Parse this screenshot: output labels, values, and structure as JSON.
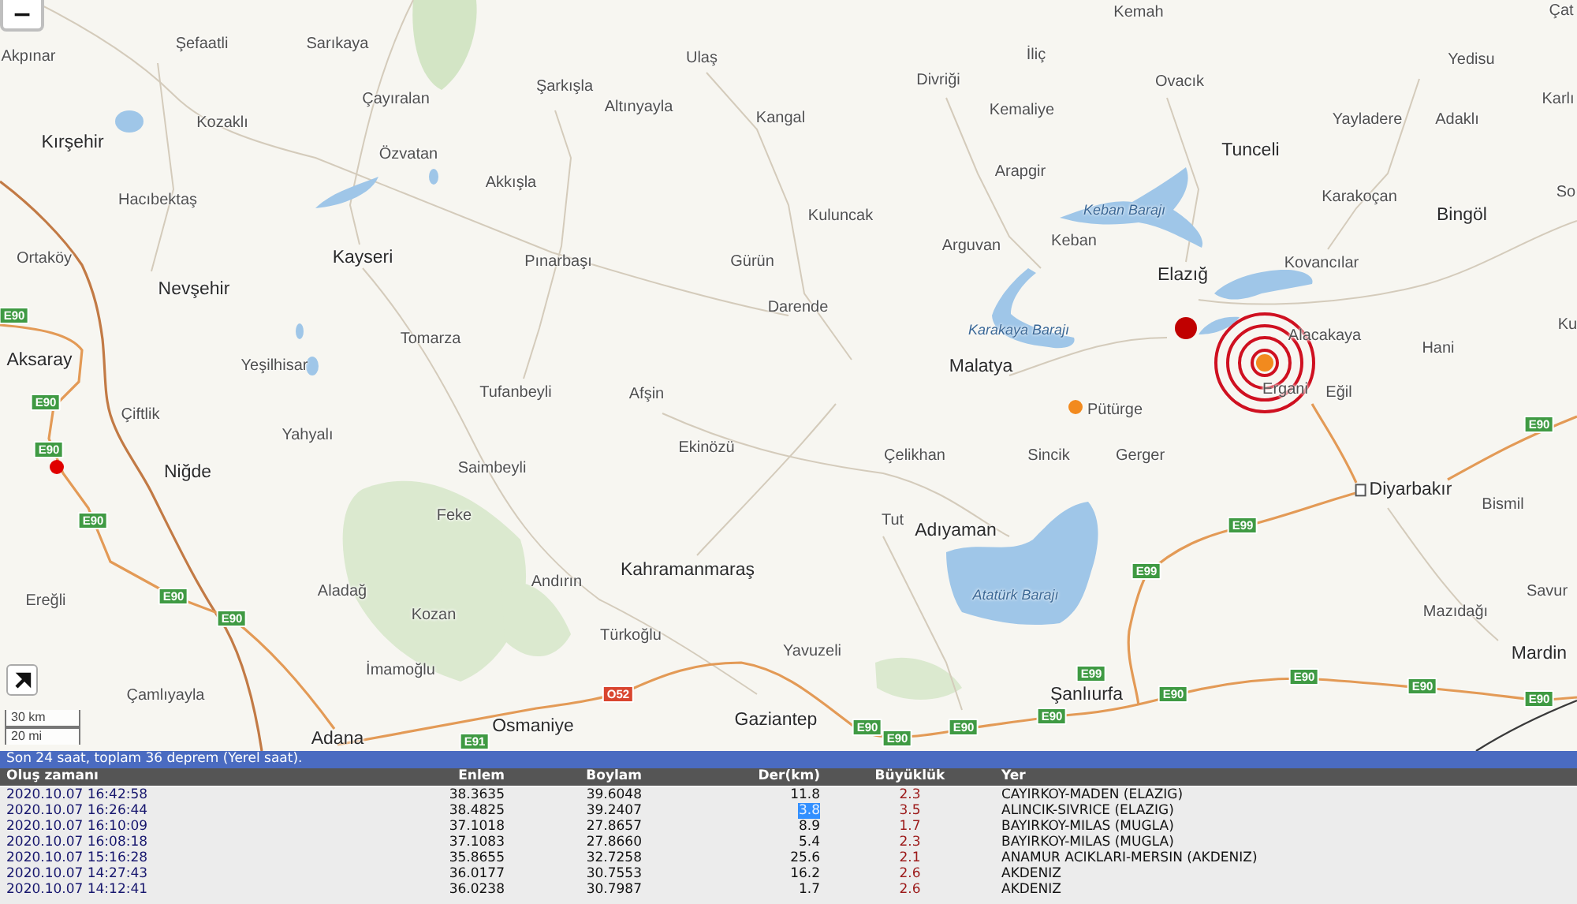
{
  "map": {
    "zoom_out": "−",
    "scale": [
      "30 km",
      "20 mi"
    ],
    "places": [
      {
        "name": "Kemah",
        "kind": "town"
      },
      {
        "name": "Çat",
        "kind": "town"
      },
      {
        "name": "Şefaatli",
        "kind": "town"
      },
      {
        "name": "Sarıkaya",
        "kind": "town"
      },
      {
        "name": "Akpınar",
        "kind": "town"
      },
      {
        "name": "Ulaş",
        "kind": "town"
      },
      {
        "name": "İliç",
        "kind": "town"
      },
      {
        "name": "Yedisu",
        "kind": "town"
      },
      {
        "name": "Şarkışla",
        "kind": "town"
      },
      {
        "name": "Divriği",
        "kind": "town"
      },
      {
        "name": "Ovacık",
        "kind": "town"
      },
      {
        "name": "Çayıralan",
        "kind": "town"
      },
      {
        "name": "Karlı",
        "kind": "town"
      },
      {
        "name": "Kozaklı",
        "kind": "town"
      },
      {
        "name": "Altınyayla",
        "kind": "town"
      },
      {
        "name": "Kangal",
        "kind": "town"
      },
      {
        "name": "Kemaliye",
        "kind": "town"
      },
      {
        "name": "Yayladere",
        "kind": "town"
      },
      {
        "name": "Adaklı",
        "kind": "town"
      },
      {
        "name": "Kırşehir",
        "kind": "city"
      },
      {
        "name": "Özvatan",
        "kind": "town"
      },
      {
        "name": "Tunceli",
        "kind": "city"
      },
      {
        "name": "Arapgir",
        "kind": "town"
      },
      {
        "name": "Hacıbektaş",
        "kind": "town"
      },
      {
        "name": "Akkışla",
        "kind": "town"
      },
      {
        "name": "Karakoçan",
        "kind": "town"
      },
      {
        "name": "So",
        "kind": "town"
      },
      {
        "name": "Kuluncak",
        "kind": "town"
      },
      {
        "name": "Bingöl",
        "kind": "city"
      },
      {
        "name": "Ortaköy",
        "kind": "town"
      },
      {
        "name": "Kayseri",
        "kind": "city"
      },
      {
        "name": "Pınarbaşı",
        "kind": "town"
      },
      {
        "name": "Gürün",
        "kind": "town"
      },
      {
        "name": "Arguvan",
        "kind": "town"
      },
      {
        "name": "Keban",
        "kind": "town"
      },
      {
        "name": "Kovancılar",
        "kind": "town"
      },
      {
        "name": "Elazığ",
        "kind": "city"
      },
      {
        "name": "Nevşehir",
        "kind": "city"
      },
      {
        "name": "Darende",
        "kind": "town"
      },
      {
        "name": "Tomarza",
        "kind": "town"
      },
      {
        "name": "Alacakaya",
        "kind": "town"
      },
      {
        "name": "Hani",
        "kind": "town"
      },
      {
        "name": "Ku",
        "kind": "town"
      },
      {
        "name": "Aksaray",
        "kind": "city"
      },
      {
        "name": "Yeşilhisar",
        "kind": "town"
      },
      {
        "name": "Malatya",
        "kind": "city"
      },
      {
        "name": "Tufanbeyli",
        "kind": "town"
      },
      {
        "name": "Afşin",
        "kind": "town"
      },
      {
        "name": "Ergani",
        "kind": "town"
      },
      {
        "name": "Eğil",
        "kind": "town"
      },
      {
        "name": "Çiftlik",
        "kind": "town"
      },
      {
        "name": "Pütürge",
        "kind": "town"
      },
      {
        "name": "Yahyalı",
        "kind": "town"
      },
      {
        "name": "Ekinözü",
        "kind": "town"
      },
      {
        "name": "Çelikhan",
        "kind": "town"
      },
      {
        "name": "Sincik",
        "kind": "town"
      },
      {
        "name": "Gerger",
        "kind": "town"
      },
      {
        "name": "Niğde",
        "kind": "city"
      },
      {
        "name": "Saimbeyli",
        "kind": "town"
      },
      {
        "name": "Diyarbakır",
        "kind": "capital"
      },
      {
        "name": "Bismil",
        "kind": "town"
      },
      {
        "name": "Feke",
        "kind": "town"
      },
      {
        "name": "Tut",
        "kind": "town"
      },
      {
        "name": "Adıyaman",
        "kind": "city"
      },
      {
        "name": "Andırın",
        "kind": "town"
      },
      {
        "name": "Kahramanmaraş",
        "kind": "city"
      },
      {
        "name": "Ereğli",
        "kind": "town"
      },
      {
        "name": "Aladağ",
        "kind": "town"
      },
      {
        "name": "Kozan",
        "kind": "town"
      },
      {
        "name": "Mazıdağı",
        "kind": "town"
      },
      {
        "name": "Savur",
        "kind": "town"
      },
      {
        "name": "Türkoğlu",
        "kind": "town"
      },
      {
        "name": "Yavuzeli",
        "kind": "town"
      },
      {
        "name": "Mardin",
        "kind": "city"
      },
      {
        "name": "İmamoğlu",
        "kind": "town"
      },
      {
        "name": "Çamlıyayla",
        "kind": "town"
      },
      {
        "name": "Şanlıurfa",
        "kind": "city"
      },
      {
        "name": "Adana",
        "kind": "city"
      },
      {
        "name": "Osmaniye",
        "kind": "city"
      },
      {
        "name": "Gaziantep",
        "kind": "city"
      }
    ],
    "water_labels": [
      "Keban Barajı",
      "Karakaya Barajı",
      "Atatürk Barajı"
    ],
    "road_shields": [
      {
        "label": "E90",
        "color": "#3f9a43"
      },
      {
        "label": "E90",
        "color": "#3f9a43"
      },
      {
        "label": "E90",
        "color": "#3f9a43"
      },
      {
        "label": "E90",
        "color": "#3f9a43"
      },
      {
        "label": "E90",
        "color": "#3f9a43"
      },
      {
        "label": "E99",
        "color": "#3f9a43"
      },
      {
        "label": "E99",
        "color": "#3f9a43"
      },
      {
        "label": "E90",
        "color": "#3f9a43"
      },
      {
        "label": "E90",
        "color": "#3f9a43"
      },
      {
        "label": "O52",
        "color": "#d9452f"
      },
      {
        "label": "E99",
        "color": "#3f9a43"
      },
      {
        "label": "E90",
        "color": "#3f9a43"
      },
      {
        "label": "E90",
        "color": "#3f9a43"
      },
      {
        "label": "E90",
        "color": "#3f9a43"
      },
      {
        "label": "E90",
        "color": "#3f9a43"
      },
      {
        "label": "E91",
        "color": "#3f9a43"
      },
      {
        "label": "E90",
        "color": "#3f9a43"
      },
      {
        "label": "E90",
        "color": "#3f9a43"
      },
      {
        "label": "E90",
        "color": "#3f9a43"
      },
      {
        "label": "E90",
        "color": "#3f9a43"
      }
    ],
    "markers": [
      {
        "kind": "large",
        "color": "#c00000"
      },
      {
        "kind": "pulse",
        "color": "#f28a1e"
      },
      {
        "kind": "small",
        "color": "#f28a1e"
      },
      {
        "kind": "small",
        "color": "#e00000"
      }
    ]
  },
  "summary": "Son 24 saat, toplam 36 deprem (Yerel saat).",
  "table": {
    "columns": [
      "Oluş zamanı",
      "Enlem",
      "Boylam",
      "Der(km)",
      "Büyüklük",
      "Yer"
    ],
    "rows": [
      {
        "time": "2020.10.07 16:42:58",
        "latitude": "38.3635",
        "longitude": "39.6048",
        "depth": "11.8",
        "depth_highlighted": false,
        "magnitude": "2.3",
        "location": "CAYIRKOY-MADEN (ELAZIG)"
      },
      {
        "time": "2020.10.07 16:26:44",
        "latitude": "38.4825",
        "longitude": "39.2407",
        "depth": "3.8",
        "depth_highlighted": true,
        "magnitude": "3.5",
        "location": "ALINCIK-SIVRICE (ELAZIG)"
      },
      {
        "time": "2020.10.07 16:10:09",
        "latitude": "37.1018",
        "longitude": "27.8657",
        "depth": "8.9",
        "depth_highlighted": false,
        "magnitude": "1.7",
        "location": "BAYIRKOY-MILAS (MUGLA)"
      },
      {
        "time": "2020.10.07 16:08:18",
        "latitude": "37.1083",
        "longitude": "27.8660",
        "depth": "5.4",
        "depth_highlighted": false,
        "magnitude": "2.3",
        "location": "BAYIRKOY-MILAS (MUGLA)"
      },
      {
        "time": "2020.10.07 15:16:28",
        "latitude": "35.8655",
        "longitude": "32.7258",
        "depth": "25.6",
        "depth_highlighted": false,
        "magnitude": "2.1",
        "location": "ANAMUR ACIKLARI-MERSIN (AKDENIZ)"
      },
      {
        "time": "2020.10.07 14:27:43",
        "latitude": "36.0177",
        "longitude": "30.7553",
        "depth": "16.2",
        "depth_highlighted": false,
        "magnitude": "2.6",
        "location": "AKDENIZ"
      },
      {
        "time": "2020.10.07 14:12:41",
        "latitude": "36.0238",
        "longitude": "30.7987",
        "depth": "1.7",
        "depth_highlighted": false,
        "magnitude": "2.6",
        "location": "AKDENIZ"
      }
    ]
  }
}
